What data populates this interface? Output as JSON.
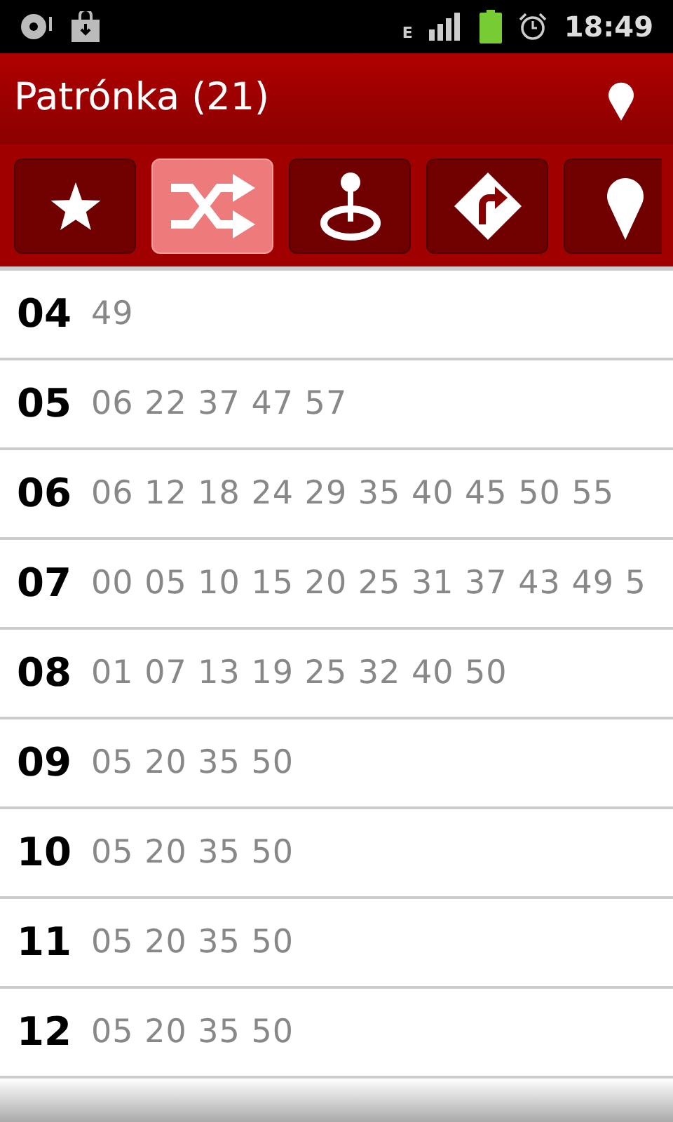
{
  "status_bar": {
    "network": "E",
    "time": "18:49"
  },
  "header": {
    "title": "Patrónka (21)"
  },
  "toolbar": [
    {
      "kind": "star",
      "selected": false
    },
    {
      "kind": "shuffle",
      "selected": true
    },
    {
      "kind": "target",
      "selected": false
    },
    {
      "kind": "turn",
      "selected": false
    },
    {
      "kind": "pin",
      "selected": false
    }
  ],
  "timetable": [
    {
      "hour": "04",
      "minutes": "49"
    },
    {
      "hour": "05",
      "minutes": "06 22 37 47 57"
    },
    {
      "hour": "06",
      "minutes": "06 12 18 24 29 35 40 45 50 55"
    },
    {
      "hour": "07",
      "minutes": "00 05 10 15 20 25 31 37 43 49 5"
    },
    {
      "hour": "08",
      "minutes": "01 07 13 19 25 32 40 50"
    },
    {
      "hour": "09",
      "minutes": "05 20 35 50"
    },
    {
      "hour": "10",
      "minutes": "05 20 35 50"
    },
    {
      "hour": "11",
      "minutes": "05 20 35 50"
    },
    {
      "hour": "12",
      "minutes": "05 20 35 50"
    }
  ]
}
